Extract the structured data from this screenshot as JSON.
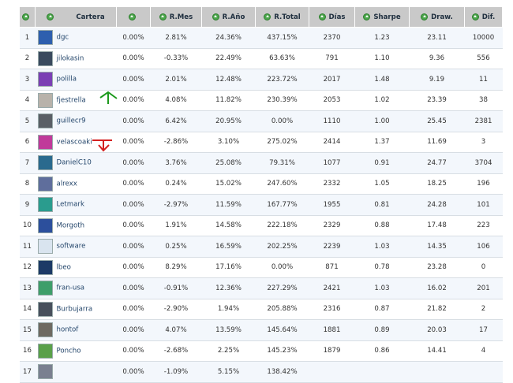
{
  "colors": {
    "positive": "#2b8a1e",
    "negative": "#d52222",
    "header_bg": "#c9c9c9",
    "row_alt": "#f3f7fc",
    "arrow_up": "#1e9a1e",
    "arrow_down": "#d42020"
  },
  "headers": {
    "cartera": "Cartera",
    "col2": "",
    "rmes": "R.Mes",
    "rano": "R.Año",
    "rtotal": "R.Total",
    "dias": "Días",
    "sharpe": "Sharpe",
    "draw": "Draw.",
    "dif": "Dif."
  },
  "rows": [
    {
      "pos": "1",
      "name": "dgc",
      "c2": "0.00%",
      "rmes": "2.81%",
      "rano": "24.36%",
      "rtotal": "437.15%",
      "dias": "2370",
      "sharpe": "1.23",
      "draw": "23.11",
      "dif": "10000",
      "avatar": "#2e5fae"
    },
    {
      "pos": "2",
      "name": "jilokasin",
      "c2": "0.00%",
      "rmes": "-0.33%",
      "rano": "22.49%",
      "rtotal": "63.63%",
      "dias": "791",
      "sharpe": "1.10",
      "draw": "9.36",
      "dif": "556",
      "avatar": "#3a4a5e"
    },
    {
      "pos": "3",
      "name": "polilla",
      "c2": "0.00%",
      "rmes": "2.01%",
      "rano": "12.48%",
      "rtotal": "223.72%",
      "dias": "2017",
      "sharpe": "1.48",
      "draw": "9.19",
      "dif": "11",
      "avatar": "#7b3fb4"
    },
    {
      "pos": "4",
      "name": "fjestrella",
      "c2": "0.00%",
      "rmes": "4.08%",
      "rano": "11.82%",
      "rtotal": "230.39%",
      "dias": "2053",
      "sharpe": "1.02",
      "draw": "23.39",
      "dif": "38",
      "avatar": "#b8b2aa"
    },
    {
      "pos": "5",
      "name": "guillecr9",
      "c2": "0.00%",
      "rmes": "6.42%",
      "rano": "20.95%",
      "rtotal": "0.00%",
      "dias": "1110",
      "sharpe": "1.00",
      "draw": "25.45",
      "dif": "2381",
      "avatar": "#5a5f66"
    },
    {
      "pos": "6",
      "name": "velascoaki",
      "c2": "0.00%",
      "rmes": "-2.86%",
      "rano": "3.10%",
      "rtotal": "275.02%",
      "dias": "2414",
      "sharpe": "1.37",
      "draw": "11.69",
      "dif": "3",
      "avatar": "#c03a9a"
    },
    {
      "pos": "7",
      "name": "DanielC10",
      "c2": "0.00%",
      "rmes": "3.76%",
      "rano": "25.08%",
      "rtotal": "79.31%",
      "dias": "1077",
      "sharpe": "0.91",
      "draw": "24.77",
      "dif": "3704",
      "avatar": "#2a6a8e"
    },
    {
      "pos": "8",
      "name": "alrexx",
      "c2": "0.00%",
      "rmes": "0.24%",
      "rano": "15.02%",
      "rtotal": "247.60%",
      "dias": "2332",
      "sharpe": "1.05",
      "draw": "18.25",
      "dif": "196",
      "avatar": "#5f6e9c"
    },
    {
      "pos": "9",
      "name": "Letmark",
      "c2": "0.00%",
      "rmes": "-2.97%",
      "rano": "11.59%",
      "rtotal": "167.77%",
      "dias": "1955",
      "sharpe": "0.81",
      "draw": "24.28",
      "dif": "101",
      "avatar": "#2a9c8e"
    },
    {
      "pos": "10",
      "name": "Morgoth",
      "c2": "0.00%",
      "rmes": "1.91%",
      "rano": "14.58%",
      "rtotal": "222.18%",
      "dias": "2329",
      "sharpe": "0.88",
      "draw": "17.48",
      "dif": "223",
      "avatar": "#2c4f9c"
    },
    {
      "pos": "11",
      "name": "software",
      "c2": "0.00%",
      "rmes": "0.25%",
      "rano": "16.59%",
      "rtotal": "202.25%",
      "dias": "2239",
      "sharpe": "1.03",
      "draw": "14.35",
      "dif": "106",
      "avatar": "#d9e4ef"
    },
    {
      "pos": "12",
      "name": "lbeo",
      "c2": "0.00%",
      "rmes": "8.29%",
      "rano": "17.16%",
      "rtotal": "0.00%",
      "dias": "871",
      "sharpe": "0.78",
      "draw": "23.28",
      "dif": "0",
      "avatar": "#1c3a66"
    },
    {
      "pos": "13",
      "name": "fran-usa",
      "c2": "0.00%",
      "rmes": "-0.91%",
      "rano": "12.36%",
      "rtotal": "227.29%",
      "dias": "2421",
      "sharpe": "1.03",
      "draw": "16.02",
      "dif": "201",
      "avatar": "#3e9e6a"
    },
    {
      "pos": "14",
      "name": "Burbujarra",
      "c2": "0.00%",
      "rmes": "-2.90%",
      "rano": "1.94%",
      "rtotal": "205.88%",
      "dias": "2316",
      "sharpe": "0.87",
      "draw": "21.82",
      "dif": "2",
      "avatar": "#48505c"
    },
    {
      "pos": "15",
      "name": "hontof",
      "c2": "0.00%",
      "rmes": "4.07%",
      "rano": "13.59%",
      "rtotal": "145.64%",
      "dias": "1881",
      "sharpe": "0.89",
      "draw": "20.03",
      "dif": "17",
      "avatar": "#6e6a62"
    },
    {
      "pos": "16",
      "name": "Poncho",
      "c2": "0.00%",
      "rmes": "-2.68%",
      "rano": "2.25%",
      "rtotal": "145.23%",
      "dias": "1879",
      "sharpe": "0.86",
      "draw": "14.41",
      "dif": "4",
      "avatar": "#5aa04a"
    },
    {
      "pos": "17",
      "name": "",
      "c2": "0.00%",
      "rmes": "-1.09%",
      "rano": "5.15%",
      "rtotal": "138.42%",
      "dias": "",
      "sharpe": "",
      "draw": "",
      "dif": "",
      "avatar": "#7a8090"
    }
  ]
}
